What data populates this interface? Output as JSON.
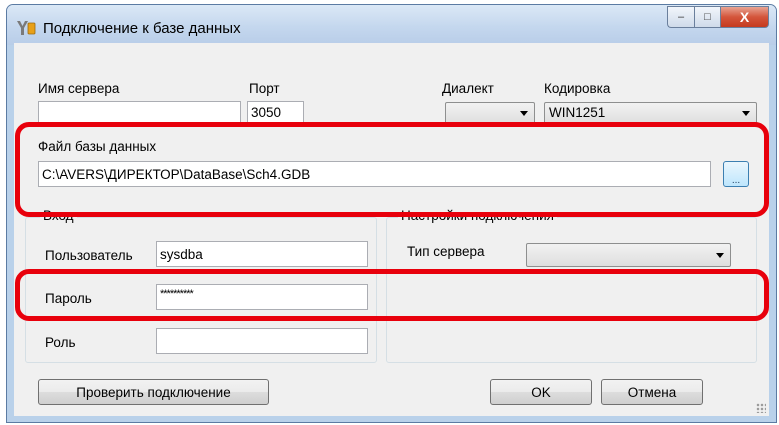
{
  "window": {
    "title": "Подключение к базе данных"
  },
  "caption": {
    "minimize": "–",
    "maximize": "□",
    "close": "X"
  },
  "server": {
    "label": "Имя сервера",
    "value": ""
  },
  "port": {
    "label": "Порт",
    "value": "3050"
  },
  "dialect": {
    "label": "Диалект",
    "value": ""
  },
  "encoding": {
    "label": "Кодировка",
    "value": "WIN1251"
  },
  "dbfile": {
    "label": "Файл базы данных",
    "value": "C:\\AVERS\\ДИРЕКТОР\\DataBase\\Sch4.GDB",
    "browse_label": "..."
  },
  "login": {
    "group_title": "Вход",
    "user_label": "Пользователь",
    "user_value": "sysdba",
    "password_label": "Пароль",
    "password_value": "**********",
    "role_label": "Роль",
    "role_value": ""
  },
  "connection": {
    "group_title": "Настройки подключения",
    "server_type_label": "Тип сервера",
    "server_type_value": ""
  },
  "buttons": {
    "test": "Проверить подключение",
    "ok": "OK",
    "cancel": "Отмена"
  },
  "colors": {
    "highlight": "#e8000c",
    "client_bg": "#f0f0f0",
    "close_button": "#c53a1e"
  }
}
